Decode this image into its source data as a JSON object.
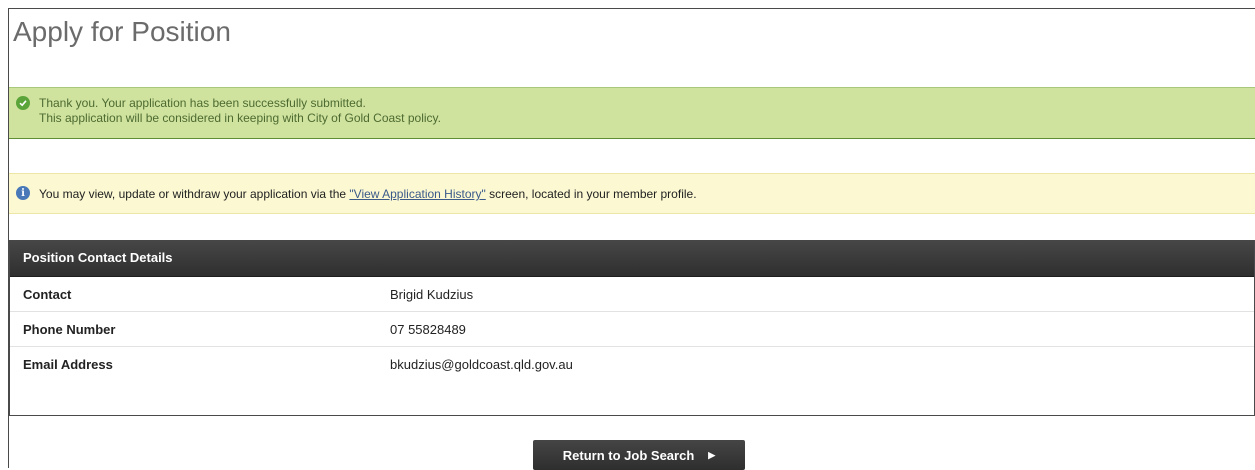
{
  "page": {
    "title": "Apply for Position"
  },
  "success": {
    "line1": "Thank you. Your application has been successfully submitted.",
    "line2": "This application will be considered in keeping with City of Gold Coast policy.",
    "icon": "check-circle-icon"
  },
  "info": {
    "prefix": "You may view, update or withdraw your application via the ",
    "link_text": "\"View Application History\"",
    "suffix": " screen, located in your member profile.",
    "icon": "info-circle-icon"
  },
  "contact": {
    "header": "Position Contact Details",
    "rows": [
      {
        "label": "Contact",
        "value": "Brigid Kudzius"
      },
      {
        "label": "Phone Number",
        "value": "07 55828489"
      },
      {
        "label": "Email Address",
        "value": "bkudzius@goldcoast.qld.gov.au"
      }
    ]
  },
  "actions": {
    "return_label": "Return to Job Search"
  },
  "colors": {
    "success_bg": "#cfe39f",
    "info_bg": "#fbf8d2",
    "header_bg": "#3a3a3a"
  }
}
